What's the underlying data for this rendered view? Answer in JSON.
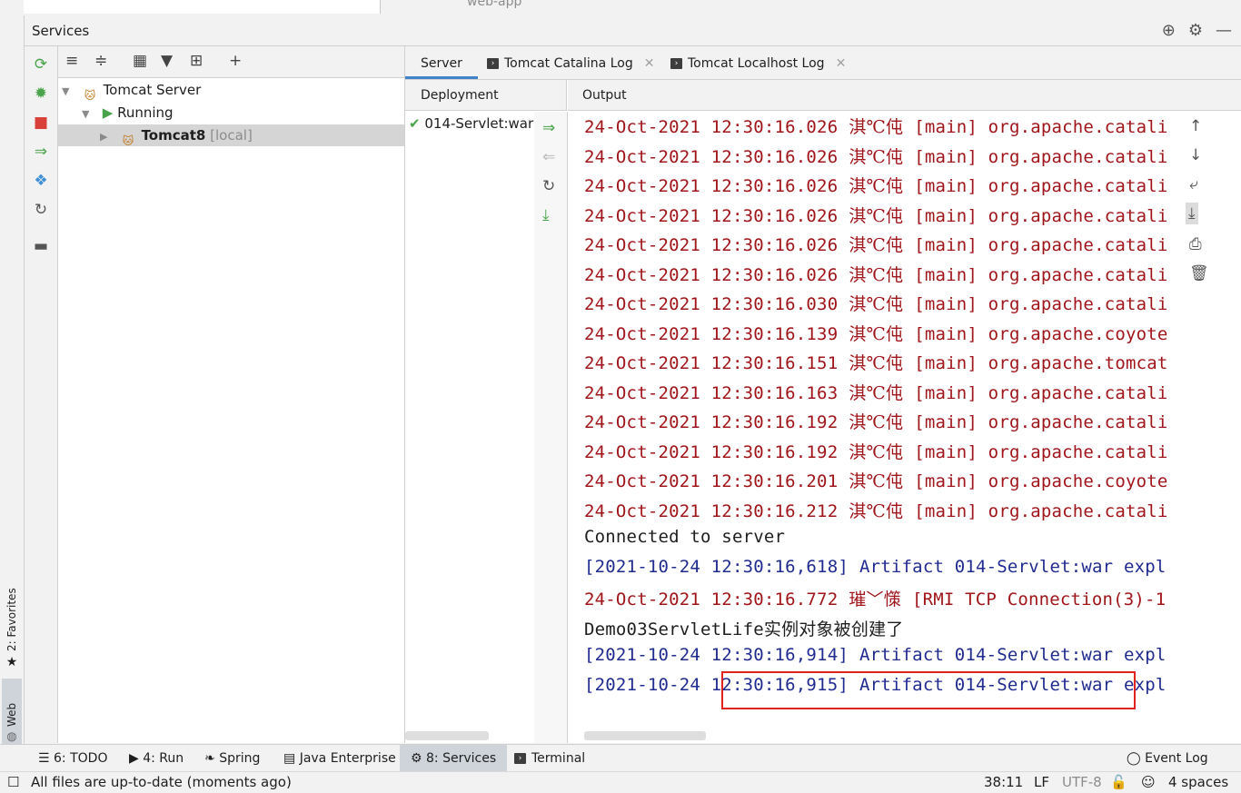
{
  "top_tabs": {
    "project": "web-app"
  },
  "services": {
    "title": "Services",
    "header_icons": [
      "target-icon",
      "gear-icon",
      "minimize-icon"
    ]
  },
  "side_rail": {
    "favorites_label": "2: Favorites",
    "web_label": "Web"
  },
  "tree": {
    "root": "Tomcat Server",
    "group": "Running",
    "server_name": "Tomcat8",
    "server_suffix": "[local]"
  },
  "tabs": [
    {
      "label": "Server",
      "active": true
    },
    {
      "label": "Tomcat Catalina Log",
      "active": false
    },
    {
      "label": "Tomcat Localhost Log",
      "active": false
    }
  ],
  "deployment": {
    "header": "Deployment",
    "item": "014-Servlet:war"
  },
  "output": {
    "header": "Output",
    "lines": [
      {
        "ts": "24-Oct-2021 12:30:16.026",
        "level": "淇℃伅",
        "rest": "[main] org.apache.catali",
        "color": "#a0151a"
      },
      {
        "ts": "24-Oct-2021 12:30:16.026",
        "level": "淇℃伅",
        "rest": "[main] org.apache.catali",
        "color": "#a0151a"
      },
      {
        "ts": "24-Oct-2021 12:30:16.026",
        "level": "淇℃伅",
        "rest": "[main] org.apache.catali",
        "color": "#a0151a"
      },
      {
        "ts": "24-Oct-2021 12:30:16.026",
        "level": "淇℃伅",
        "rest": "[main] org.apache.catali",
        "color": "#a0151a"
      },
      {
        "ts": "24-Oct-2021 12:30:16.026",
        "level": "淇℃伅",
        "rest": "[main] org.apache.catali",
        "color": "#a0151a"
      },
      {
        "ts": "24-Oct-2021 12:30:16.026",
        "level": "淇℃伅",
        "rest": "[main] org.apache.catali",
        "color": "#a0151a"
      },
      {
        "ts": "24-Oct-2021 12:30:16.030",
        "level": "淇℃伅",
        "rest": "[main] org.apache.catali",
        "color": "#a0151a"
      },
      {
        "ts": "24-Oct-2021 12:30:16.139",
        "level": "淇℃伅",
        "rest": "[main] org.apache.coyote",
        "color": "#a0151a"
      },
      {
        "ts": "24-Oct-2021 12:30:16.151",
        "level": "淇℃伅",
        "rest": "[main] org.apache.tomcat",
        "color": "#a0151a"
      },
      {
        "ts": "24-Oct-2021 12:30:16.163",
        "level": "淇℃伅",
        "rest": "[main] org.apache.catali",
        "color": "#a0151a"
      },
      {
        "ts": "24-Oct-2021 12:30:16.192",
        "level": "淇℃伅",
        "rest": "[main] org.apache.catali",
        "color": "#a0151a"
      },
      {
        "ts": "24-Oct-2021 12:30:16.192",
        "level": "淇℃伅",
        "rest": "[main] org.apache.catali",
        "color": "#a0151a"
      },
      {
        "ts": "24-Oct-2021 12:30:16.201",
        "level": "淇℃伅",
        "rest": "[main] org.apache.coyote",
        "color": "#a0151a"
      },
      {
        "ts": "24-Oct-2021 12:30:16.212",
        "level": "淇℃伅",
        "rest": "[main] org.apache.catali",
        "color": "#a0151a"
      },
      {
        "ts": "Connected to server",
        "level": "",
        "rest": "",
        "color": "#1e1e1e"
      },
      {
        "ts": "[2021-10-24 12:30:16,618]",
        "level": "",
        "rest": "Artifact 014-Servlet:war expl",
        "color": "#202b8f"
      },
      {
        "ts": "24-Oct-2021 12:30:16.772",
        "level": "璀﹀憡",
        "rest": "[RMI TCP Connection(3)-1",
        "color": "#a0151a"
      },
      {
        "ts": "Demo03ServletLife",
        "level": "实例对象被创建了",
        "rest": "",
        "color": "#1e1e1e"
      },
      {
        "ts": "[2021-10-24 12:30:16,914]",
        "level": "",
        "rest": "Artifact 014-Servlet:war expl",
        "color": "#202b8f"
      },
      {
        "ts": "[2021-10-24 12:30:16,915]",
        "level": "",
        "rest": "Artifact 014-Servlet:war expl",
        "color": "#202b8f"
      }
    ]
  },
  "bottom_tabs": [
    {
      "label": "6: TODO",
      "active": false
    },
    {
      "label": "4: Run",
      "active": false
    },
    {
      "label": "Spring",
      "active": false
    },
    {
      "label": "Java Enterprise",
      "active": false
    },
    {
      "label": "8: Services",
      "active": true
    },
    {
      "label": "Terminal",
      "active": false
    }
  ],
  "event_log": "Event Log",
  "status": {
    "message": "All files are up-to-date (moments ago)",
    "position": "38:11",
    "line_sep": "LF",
    "encoding": "UTF-8",
    "indent": "4 spaces"
  },
  "colors": {
    "accent": "#4083c9",
    "highlight_box": "#e0231c",
    "green": "#49a34a",
    "stop_red": "#d9403a"
  }
}
